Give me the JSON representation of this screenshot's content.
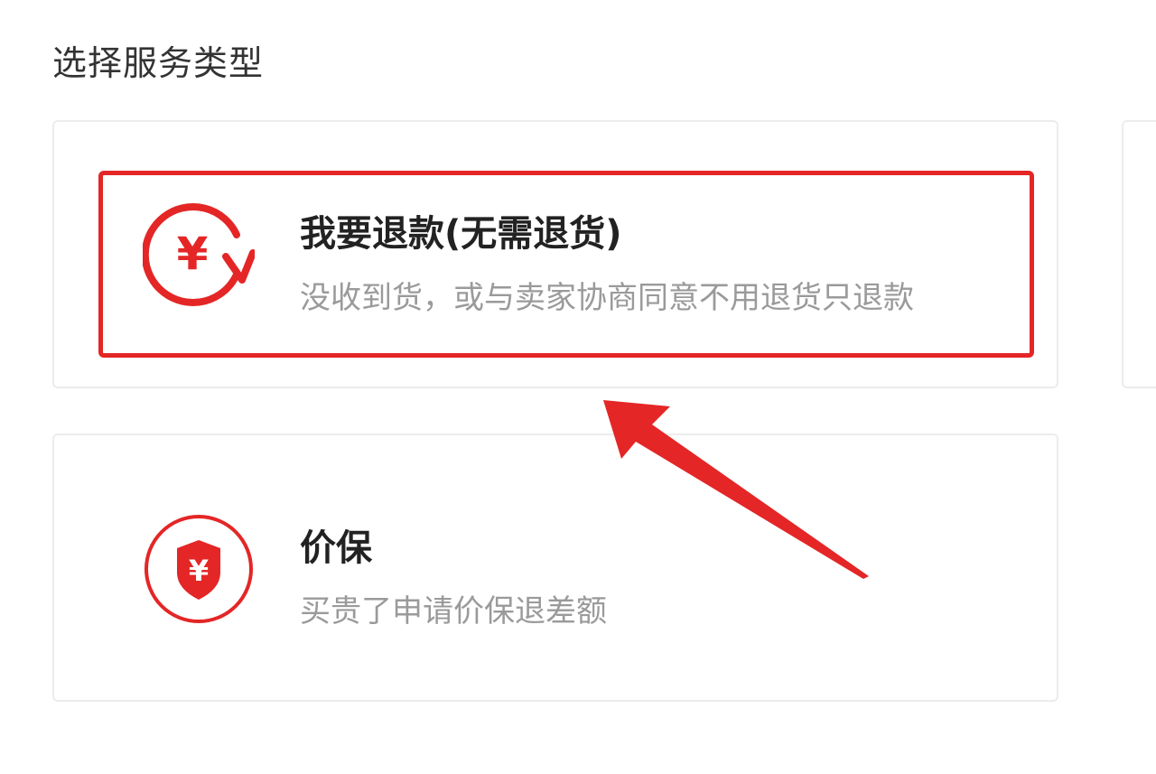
{
  "header": {
    "title": "选择服务类型"
  },
  "options": [
    {
      "title": "我要退款(无需退货)",
      "description": "没收到货，或与卖家协商同意不用退货只退款",
      "icon": "refund-yuan-circle-arrow-icon"
    },
    {
      "title": "价保",
      "description": "买贵了申请价保退差额",
      "icon": "price-protection-shield-yuan-icon"
    }
  ],
  "icon_glyphs": {
    "yuan": "¥"
  },
  "colors": {
    "accent": "#e42626",
    "title_text": "#222222",
    "description_text": "#9a9a9a",
    "card_border": "#ececec"
  }
}
